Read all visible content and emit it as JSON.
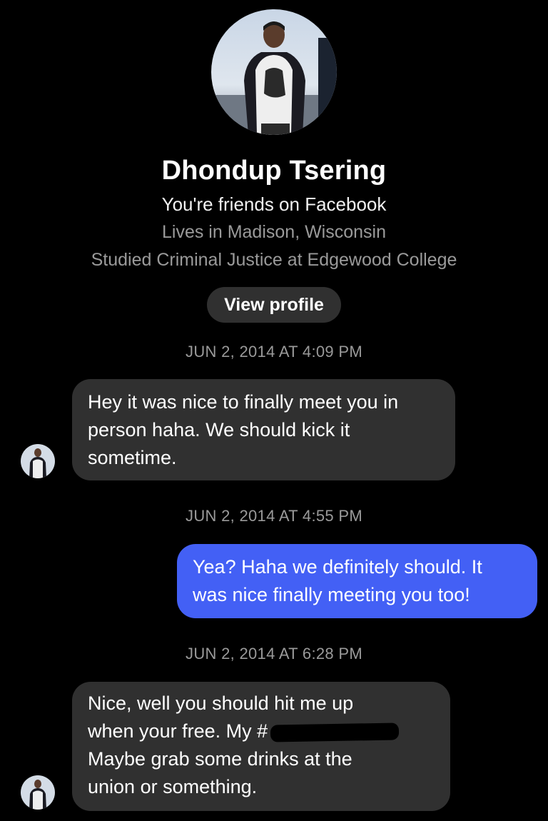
{
  "profile": {
    "name": "Dhondup Tsering",
    "friend_status": "You're friends on Facebook",
    "lives": "Lives in Madison, Wisconsin",
    "studied": "Studied Criminal Justice at Edgewood College",
    "view_profile_label": "View profile"
  },
  "messages": [
    {
      "timestamp": "JUN 2, 2014 AT 4:09 PM",
      "direction": "incoming",
      "lines": [
        "Hey it was nice to finally meet you in",
        "person haha. We should kick it",
        "sometime."
      ]
    },
    {
      "timestamp": "JUN 2, 2014 AT 4:55 PM",
      "direction": "outgoing",
      "lines": [
        "Yea? Haha we definitely should. It",
        "was nice finally meeting you too!"
      ]
    },
    {
      "timestamp": "JUN 2, 2014 AT 6:28 PM",
      "direction": "incoming",
      "lines": [
        "Nice, well you should hit me up",
        "when your free. My #",
        "Maybe grab some drinks at the",
        "union or something."
      ]
    }
  ],
  "colors": {
    "background": "#000000",
    "incoming_bubble": "#303030",
    "outgoing_bubble": "#4360f5",
    "secondary_text": "#9a9a9a"
  }
}
